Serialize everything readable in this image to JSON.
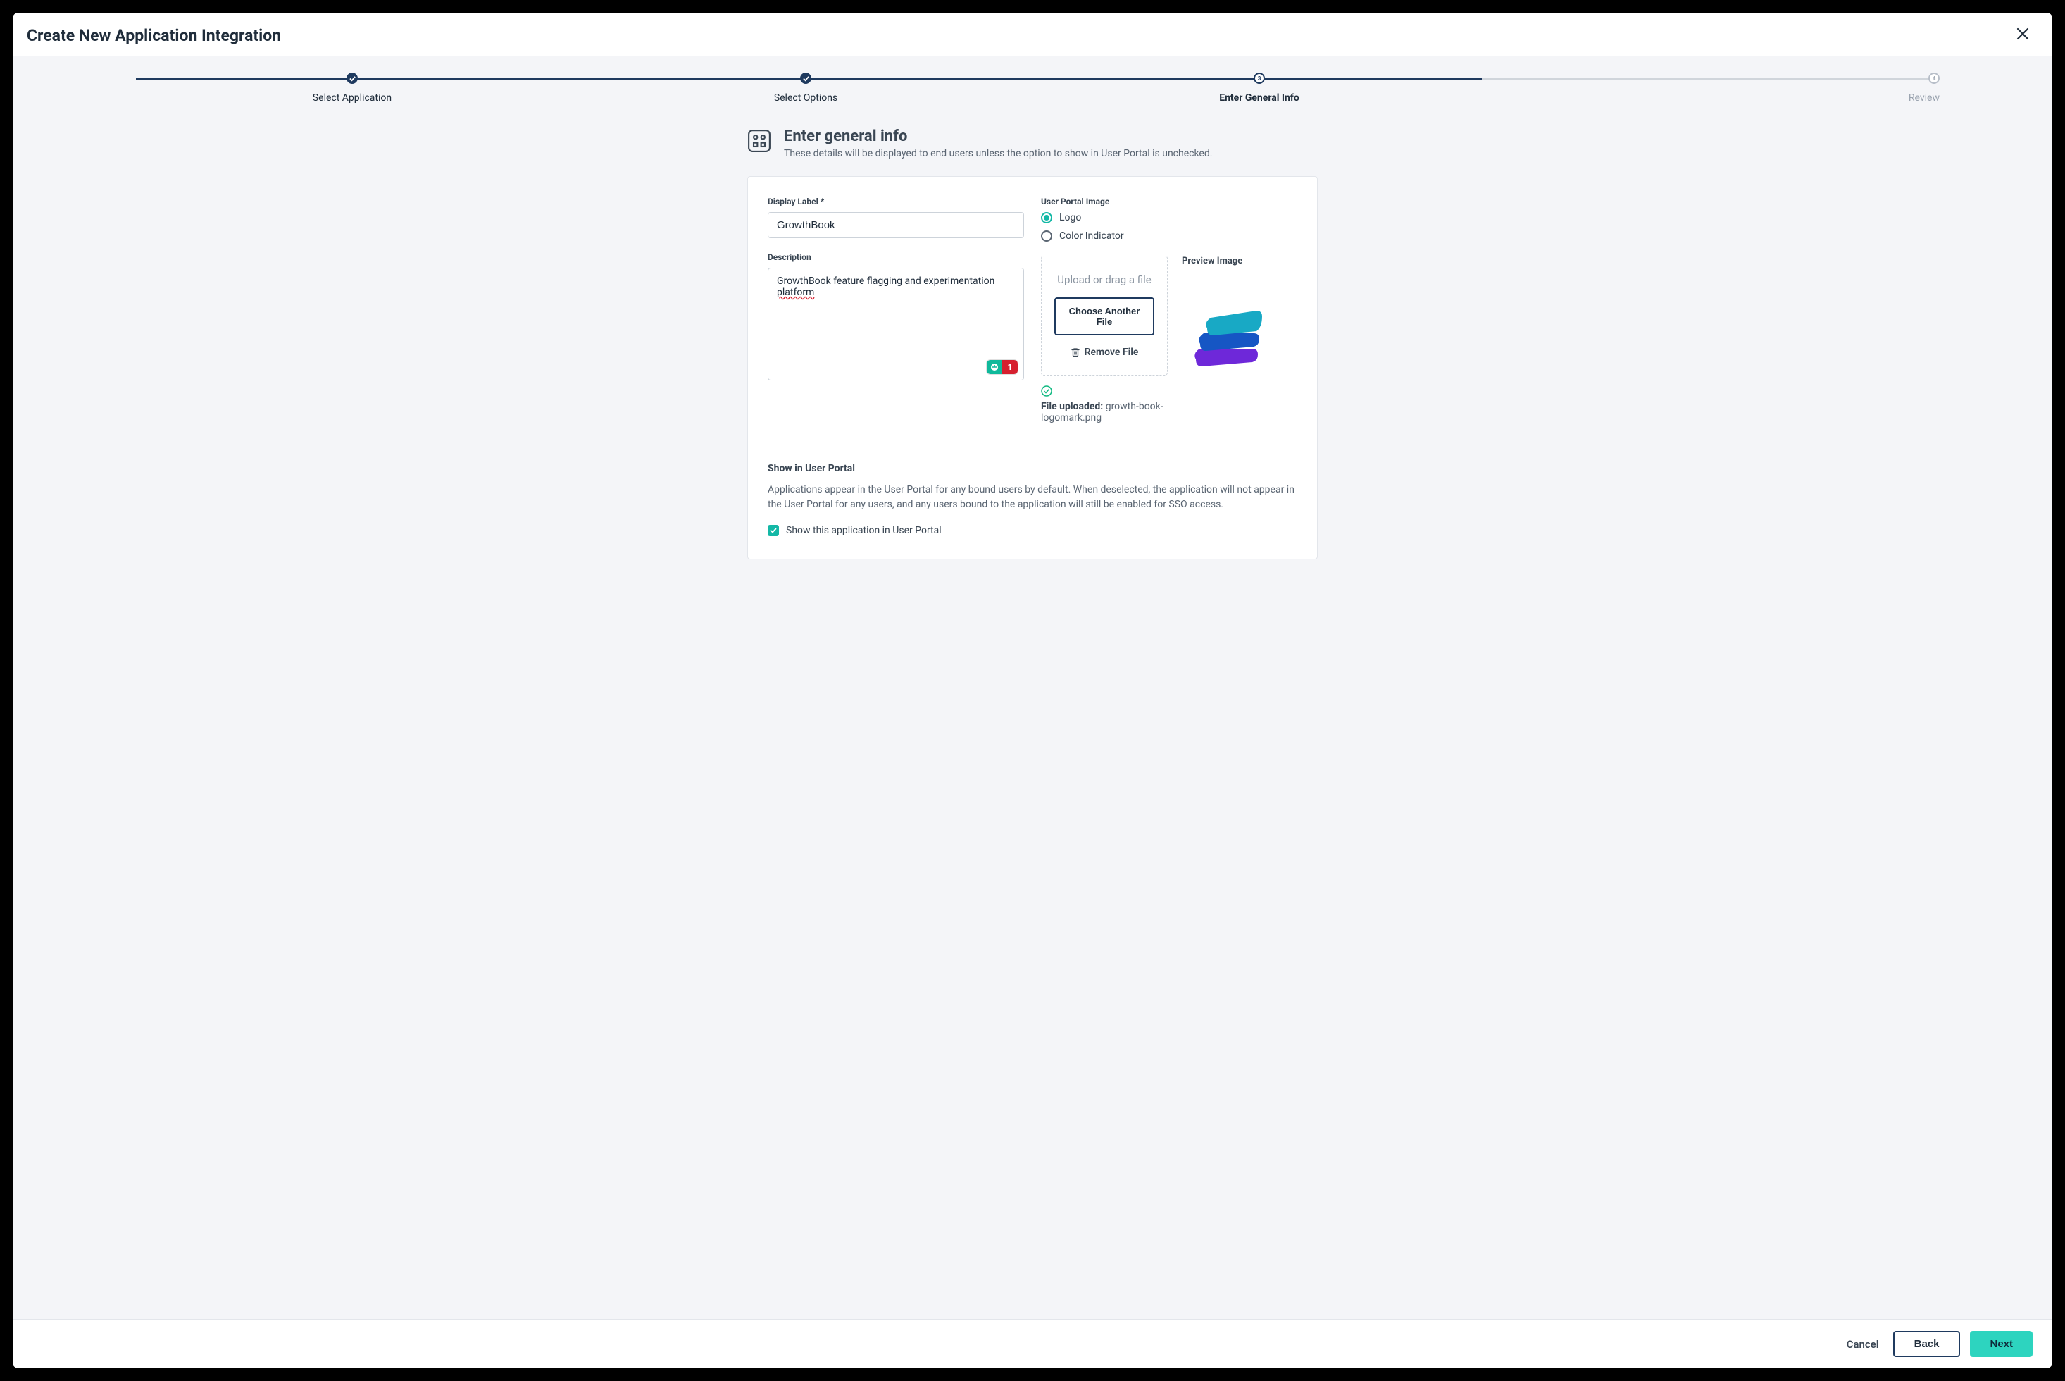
{
  "modal": {
    "title": "Create New Application Integration"
  },
  "stepper": {
    "steps": [
      {
        "label": "Select Application",
        "state": "done"
      },
      {
        "label": "Select Options",
        "state": "done"
      },
      {
        "label": "Enter General Info",
        "state": "current",
        "num": "3"
      },
      {
        "label": "Review",
        "state": "future",
        "num": "4"
      }
    ]
  },
  "section": {
    "title": "Enter general info",
    "subtitle": "These details will be displayed to end users unless the option to show in User Portal is unchecked."
  },
  "form": {
    "display_label_label": "Display Label *",
    "display_label_value": "GrowthBook",
    "description_label": "Description",
    "description_value": "GrowthBook feature flagging and experimentation platform",
    "grammar_count": "1",
    "user_portal_image_label": "User Portal Image",
    "radio_logo": "Logo",
    "radio_color": "Color Indicator",
    "dropzone_hint": "Upload or drag a file",
    "choose_button": "Choose Another File",
    "remove_file": "Remove File",
    "file_uploaded_label": "File uploaded:",
    "file_name": "growth-book-logomark.png",
    "preview_label": "Preview Image"
  },
  "portal": {
    "title": "Show in User Portal",
    "description": "Applications appear in the User Portal for any bound users by default. When deselected, the application will not appear in the User Portal for any users, and any users bound to the application will still be enabled for SSO access.",
    "checkbox_label": "Show this application in User Portal"
  },
  "footer": {
    "cancel": "Cancel",
    "back": "Back",
    "next": "Next"
  }
}
